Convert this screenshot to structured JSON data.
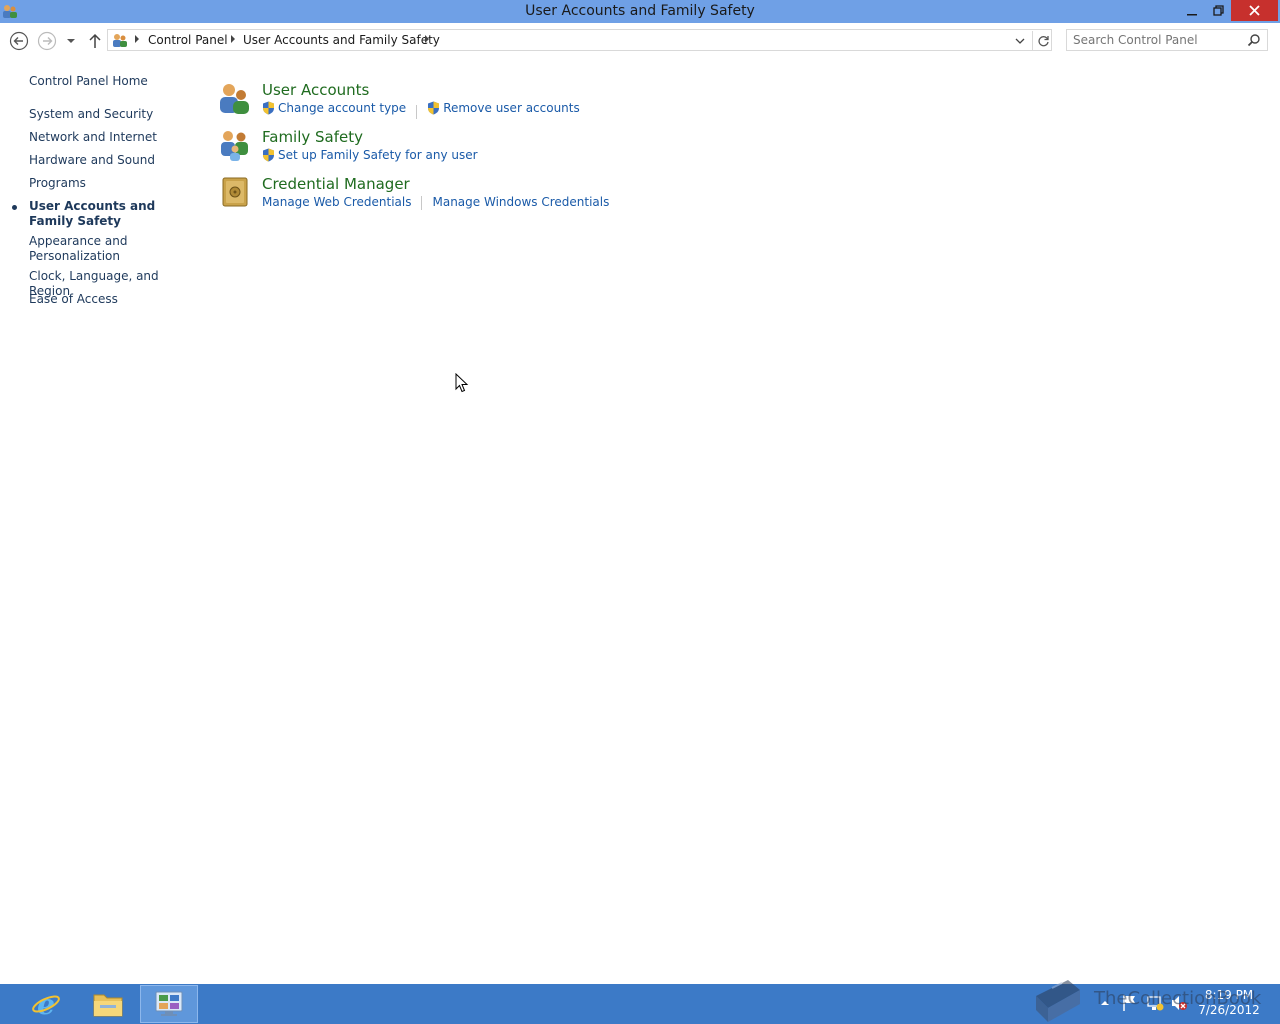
{
  "window": {
    "title": "User Accounts and Family Safety"
  },
  "navigation": {
    "breadcrumb": [
      "Control Panel",
      "User Accounts and Family Safety"
    ],
    "search_placeholder": "Search Control Panel"
  },
  "sidebar": {
    "items": [
      {
        "label": "Control Panel Home"
      },
      {
        "label": "System and Security"
      },
      {
        "label": "Network and Internet"
      },
      {
        "label": "Hardware and Sound"
      },
      {
        "label": "Programs"
      },
      {
        "label": "User Accounts and Family Safety",
        "current": true
      },
      {
        "label": "Appearance and Personalization"
      },
      {
        "label": "Clock, Language, and Region"
      },
      {
        "label": "Ease of Access"
      }
    ]
  },
  "categories": [
    {
      "title": "User Accounts",
      "icon": "users-icon",
      "links": [
        {
          "label": "Change account type",
          "shield": true
        },
        {
          "label": "Remove user accounts",
          "shield": true
        }
      ]
    },
    {
      "title": "Family Safety",
      "icon": "family-safety-icon",
      "links": [
        {
          "label": "Set up Family Safety for any user",
          "shield": true
        }
      ]
    },
    {
      "title": "Credential Manager",
      "icon": "vault-icon",
      "links": [
        {
          "label": "Manage Web Credentials",
          "shield": false
        },
        {
          "label": "Manage Windows Credentials",
          "shield": false
        }
      ]
    }
  ],
  "taskbar": {
    "apps": [
      "internet-explorer-icon",
      "file-explorer-icon",
      "control-panel-icon"
    ],
    "clock_time": "8:19 PM",
    "clock_date": "7/26/2012"
  },
  "watermark": {
    "text": "TheCollectionBook"
  },
  "colors": {
    "titlebar": "#6fa0e6",
    "close": "#c7302d",
    "link": "#1a5aa8",
    "category_title": "#1f6b1f",
    "taskbar": "#3c7ac7"
  }
}
